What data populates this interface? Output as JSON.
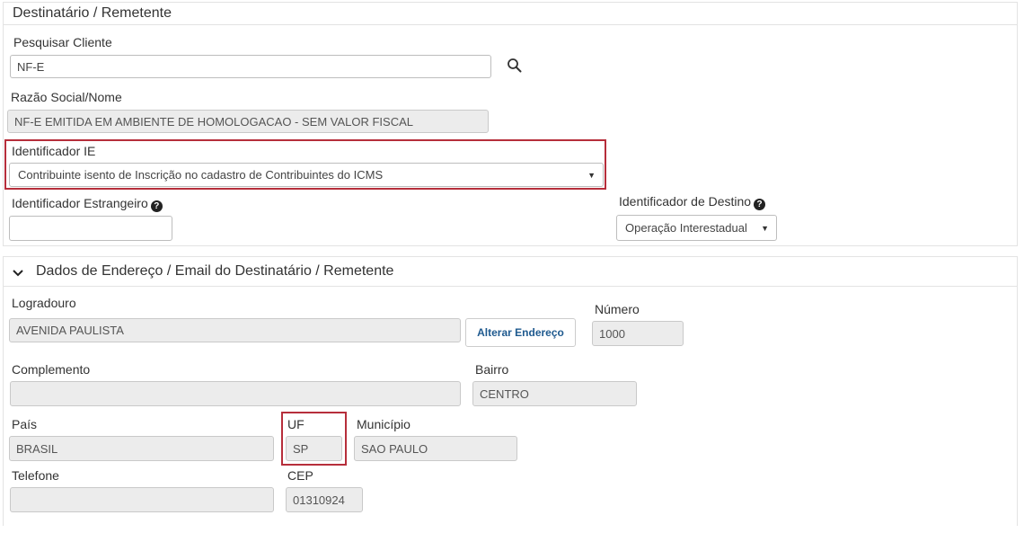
{
  "section1": {
    "title": "Destinatário / Remetente",
    "pesquisar_cliente": {
      "label": "Pesquisar Cliente",
      "value": "NF-E"
    },
    "razao_social": {
      "label": "Razão Social/Nome",
      "value": "NF-E EMITIDA EM AMBIENTE DE HOMOLOGACAO - SEM VALOR FISCAL"
    },
    "identificador_ie": {
      "label": "Identificador IE",
      "value": "Contribuinte isento de Inscrição no cadastro de Contribuintes do ICMS"
    },
    "identificador_estrangeiro": {
      "label": "Identificador Estrangeiro",
      "value": ""
    },
    "identificador_destino": {
      "label": "Identificador de Destino",
      "value": "Operação Interestadual"
    }
  },
  "section2": {
    "title": "Dados de Endereço / Email do Destinatário / Remetente",
    "logradouro": {
      "label": "Logradouro",
      "value": "AVENIDA PAULISTA"
    },
    "alterar_endereco": "Alterar Endereço",
    "numero": {
      "label": "Número",
      "value": "1000"
    },
    "complemento": {
      "label": "Complemento",
      "value": ""
    },
    "bairro": {
      "label": "Bairro",
      "value": "CENTRO"
    },
    "pais": {
      "label": "País",
      "value": "BRASIL"
    },
    "uf": {
      "label": "UF",
      "value": "SP"
    },
    "municipio": {
      "label": "Município",
      "value": "SAO PAULO"
    },
    "telefone": {
      "label": "Telefone",
      "value": ""
    },
    "cep": {
      "label": "CEP",
      "value": "01310924"
    }
  },
  "icons": {
    "search": "search-icon",
    "help": "question-circle-icon",
    "chevron": "chevron-down-icon",
    "caret": "caret-down-icon"
  },
  "colors": {
    "highlight": "#b62e3b",
    "button_text": "#1f5a8f",
    "readonly_bg": "#ececec"
  }
}
